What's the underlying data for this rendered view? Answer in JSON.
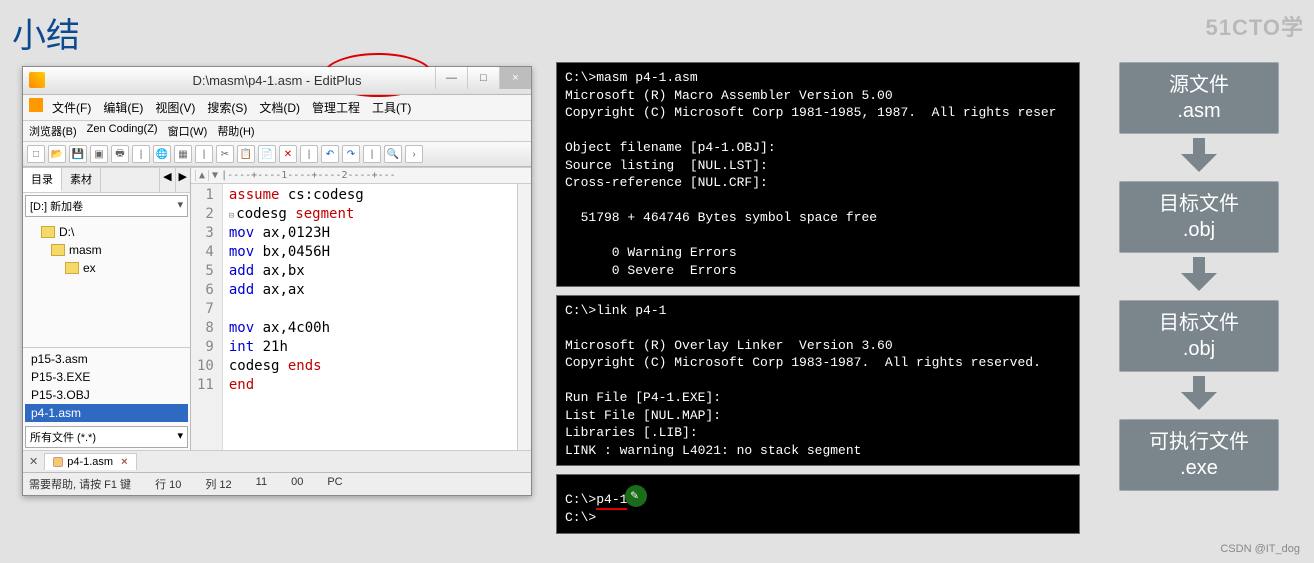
{
  "page": {
    "title": "小结",
    "wm_tr": "51CTO学",
    "wm_br": "CSDN @IT_dog"
  },
  "editor": {
    "title": "D:\\masm\\p4-1.asm - EditPlus",
    "win": {
      "min": "—",
      "max": "□",
      "close": "×"
    },
    "menu": [
      "文件(F)",
      "编辑(E)",
      "视图(V)",
      "搜索(S)",
      "文档(D)",
      "管理工程",
      "工具(T)"
    ],
    "menu2": [
      "浏览器(B)",
      "Zen Coding(Z)",
      "窗口(W)",
      "帮助(H)"
    ],
    "panel": {
      "tab1": "目录",
      "tab2": "素材",
      "drive": "[D:] 新加卷",
      "tree": [
        {
          "l": "D:\\",
          "lv": 0
        },
        {
          "l": "masm",
          "lv": 1
        },
        {
          "l": "ex",
          "lv": 2
        }
      ],
      "files": [
        "p15-3.asm",
        "P15-3.EXE",
        "P15-3.OBJ",
        "p4-1.asm"
      ],
      "filter": "所有文件 (*.*)"
    },
    "ruler_nav": [
      "▲",
      "▼"
    ],
    "ruler": "|----+----1----+----2----+---",
    "code": {
      "lines": [
        {
          "n": 1,
          "i": "",
          "tokens": [
            {
              "t": "assume",
              "c": "kw-red"
            },
            {
              "t": " cs:codesg",
              "c": ""
            }
          ]
        },
        {
          "n": 2,
          "i": "⊟",
          "tokens": [
            {
              "t": "codesg ",
              "c": ""
            },
            {
              "t": "segment",
              "c": "kw-red"
            }
          ]
        },
        {
          "n": 3,
          "i": "",
          "tokens": [
            {
              "t": "    ",
              "c": ""
            },
            {
              "t": "mov",
              "c": "kw-blue"
            },
            {
              "t": " ax,0123H",
              "c": ""
            }
          ]
        },
        {
          "n": 4,
          "i": "",
          "tokens": [
            {
              "t": "    ",
              "c": ""
            },
            {
              "t": "mov",
              "c": "kw-blue"
            },
            {
              "t": " bx,0456H",
              "c": ""
            }
          ]
        },
        {
          "n": 5,
          "i": "",
          "tokens": [
            {
              "t": "    ",
              "c": ""
            },
            {
              "t": "add",
              "c": "kw-blue"
            },
            {
              "t": " ax,bx",
              "c": ""
            }
          ]
        },
        {
          "n": 6,
          "i": "",
          "tokens": [
            {
              "t": "    ",
              "c": ""
            },
            {
              "t": "add",
              "c": "kw-blue"
            },
            {
              "t": " ax,ax",
              "c": ""
            }
          ]
        },
        {
          "n": 7,
          "i": "",
          "tokens": []
        },
        {
          "n": 8,
          "i": "",
          "tokens": [
            {
              "t": "    ",
              "c": ""
            },
            {
              "t": "mov",
              "c": "kw-blue"
            },
            {
              "t": " ax,4c00h",
              "c": ""
            }
          ]
        },
        {
          "n": 9,
          "i": "",
          "tokens": [
            {
              "t": "    ",
              "c": ""
            },
            {
              "t": "int",
              "c": "kw-blue"
            },
            {
              "t": " 21h",
              "c": ""
            }
          ]
        },
        {
          "n": 10,
          "i": "",
          "tokens": [
            {
              "t": "codesg ",
              "c": ""
            },
            {
              "t": "ends",
              "c": "kw-red"
            }
          ]
        },
        {
          "n": 11,
          "i": "",
          "tokens": [
            {
              "t": "end",
              "c": "kw-red"
            }
          ]
        }
      ]
    },
    "tab": "p4-1.asm",
    "status": {
      "help": "需要帮助, 请按 F1 键",
      "ln": "行 10",
      "col": "列 12",
      "c2": "11",
      "c3": "00",
      "c4": "PC"
    }
  },
  "terms": {
    "masm": "C:\\>masm p4-1.asm\nMicrosoft (R) Macro Assembler Version 5.00\nCopyright (C) Microsoft Corp 1981-1985, 1987.  All rights reser\n\nObject filename [p4-1.OBJ]:\nSource listing  [NUL.LST]:\nCross-reference [NUL.CRF]:\n\n  51798 + 464746 Bytes symbol space free\n\n      0 Warning Errors\n      0 Severe  Errors",
    "link": "C:\\>link p4-1\n\nMicrosoft (R) Overlay Linker  Version 3.60\nCopyright (C) Microsoft Corp 1983-1987.  All rights reserved.\n\nRun File [P4-1.EXE]:\nList File [NUL.MAP]:\nLibraries [.LIB]:\nLINK : warning L4021: no stack segment",
    "run_pre": "C:\\>",
    "run_cmd": "p4-1",
    "run_after": "\nC:\\>"
  },
  "flow": [
    {
      "h": "源文件",
      "s": ".asm"
    },
    {
      "h": "目标文件",
      "s": ".obj"
    },
    {
      "h": "目标文件",
      "s": ".obj"
    },
    {
      "h": "可执行文件",
      "s": ".exe"
    }
  ]
}
